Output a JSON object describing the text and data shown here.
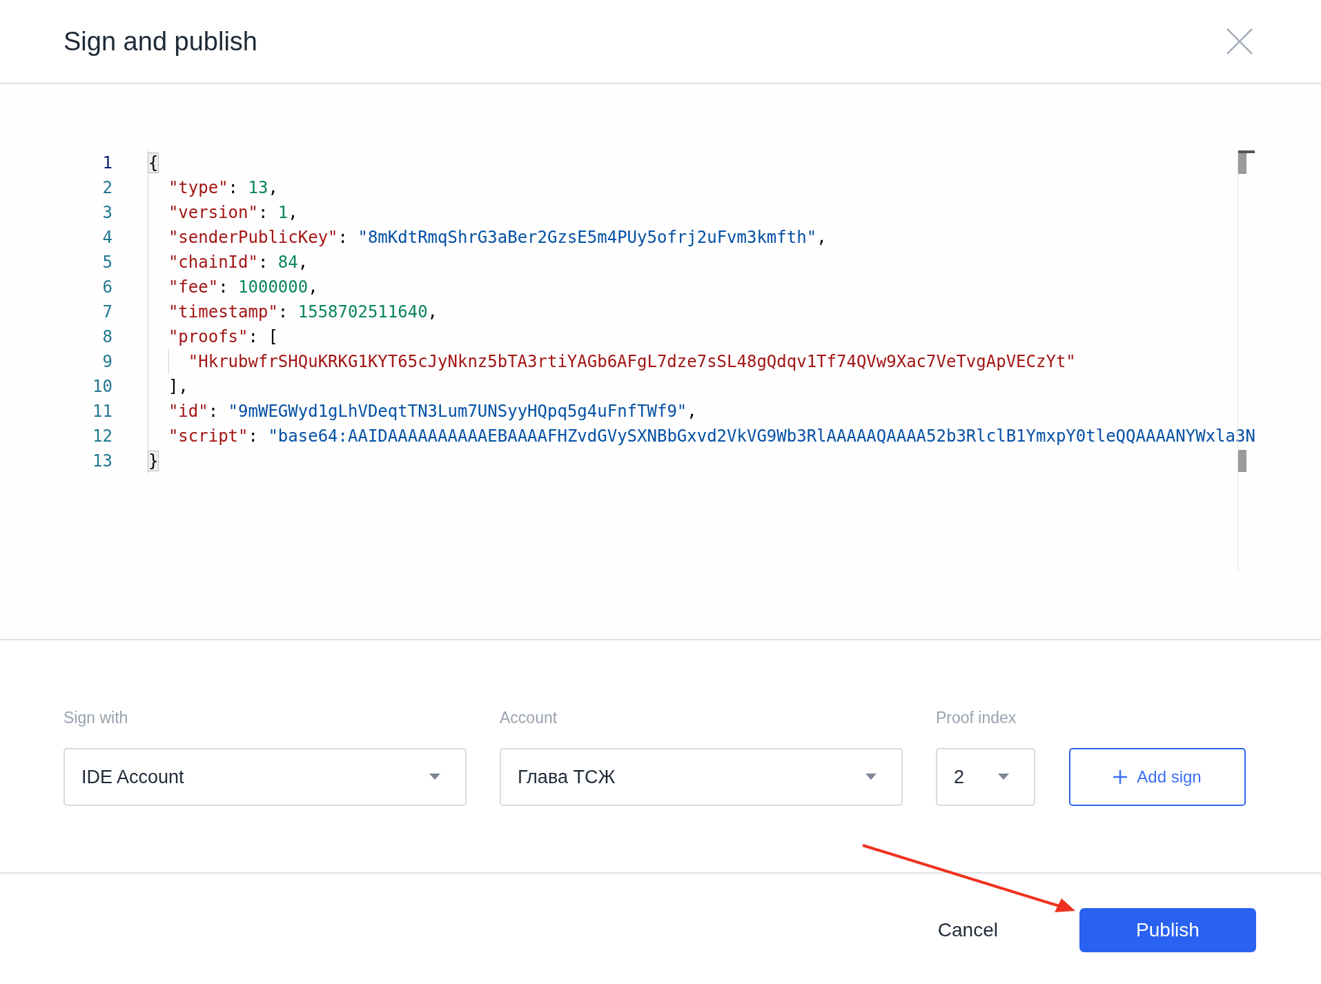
{
  "dialog": {
    "title": "Sign and publish"
  },
  "editor": {
    "lines": [
      {
        "number": "1",
        "active": true,
        "tokens": [
          {
            "kind": "bracket",
            "text": "{"
          }
        ]
      },
      {
        "number": "2",
        "active": false,
        "tokens": [
          {
            "kind": "key",
            "text": "  \"type\""
          },
          {
            "kind": "punct",
            "text": ": "
          },
          {
            "kind": "number",
            "text": "13"
          },
          {
            "kind": "punct",
            "text": ","
          }
        ]
      },
      {
        "number": "3",
        "active": false,
        "tokens": [
          {
            "kind": "key",
            "text": "  \"version\""
          },
          {
            "kind": "punct",
            "text": ": "
          },
          {
            "kind": "number",
            "text": "1"
          },
          {
            "kind": "punct",
            "text": ","
          }
        ]
      },
      {
        "number": "4",
        "active": false,
        "tokens": [
          {
            "kind": "key",
            "text": "  \"senderPublicKey\""
          },
          {
            "kind": "punct",
            "text": ": "
          },
          {
            "kind": "string",
            "text": "\"8mKdtRmqShrG3aBer2GzsE5m4PUy5ofrj2uFvm3kmfth\""
          },
          {
            "kind": "punct",
            "text": ","
          }
        ]
      },
      {
        "number": "5",
        "active": false,
        "tokens": [
          {
            "kind": "key",
            "text": "  \"chainId\""
          },
          {
            "kind": "punct",
            "text": ": "
          },
          {
            "kind": "number",
            "text": "84"
          },
          {
            "kind": "punct",
            "text": ","
          }
        ]
      },
      {
        "number": "6",
        "active": false,
        "tokens": [
          {
            "kind": "key",
            "text": "  \"fee\""
          },
          {
            "kind": "punct",
            "text": ": "
          },
          {
            "kind": "number",
            "text": "1000000"
          },
          {
            "kind": "punct",
            "text": ","
          }
        ]
      },
      {
        "number": "7",
        "active": false,
        "tokens": [
          {
            "kind": "key",
            "text": "  \"timestamp\""
          },
          {
            "kind": "punct",
            "text": ": "
          },
          {
            "kind": "number",
            "text": "1558702511640"
          },
          {
            "kind": "punct",
            "text": ","
          }
        ]
      },
      {
        "number": "8",
        "active": false,
        "tokens": [
          {
            "kind": "key",
            "text": "  \"proofs\""
          },
          {
            "kind": "punct",
            "text": ": ["
          }
        ]
      },
      {
        "number": "9",
        "active": false,
        "tokens": [
          {
            "kind": "key",
            "text": "    \"HkrubwfrSHQuKRKG1KYT65cJyNknz5bTA3rtiYAGb6AFgL7dze7sSL48gQdqv1Tf74QVw9Xac7VeTvgApVECzYt\""
          }
        ]
      },
      {
        "number": "10",
        "active": false,
        "tokens": [
          {
            "kind": "punct",
            "text": "  ],"
          }
        ]
      },
      {
        "number": "11",
        "active": false,
        "tokens": [
          {
            "kind": "key",
            "text": "  \"id\""
          },
          {
            "kind": "punct",
            "text": ": "
          },
          {
            "kind": "string",
            "text": "\"9mWEGWyd1gLhVDeqtTN3Lum7UNSyyHQpq5g4uFnfTWf9\""
          },
          {
            "kind": "punct",
            "text": ","
          }
        ]
      },
      {
        "number": "12",
        "active": false,
        "tokens": [
          {
            "kind": "key",
            "text": "  \"script\""
          },
          {
            "kind": "punct",
            "text": ": "
          },
          {
            "kind": "string",
            "text": "\"base64:AAIDAAAAAAAAAAEBAAAAFHZvdGVySXNBbGxvd2VkVG9Wb3RlAAAAAQAAAA52b3RlclB1YmxpY0tleQQAAAANYWxla3N"
          }
        ]
      },
      {
        "number": "13",
        "active": false,
        "tokens": [
          {
            "kind": "bracket",
            "text": "}"
          }
        ]
      }
    ]
  },
  "form": {
    "fields": [
      {
        "label": "Sign with",
        "value": "IDE Account"
      },
      {
        "label": "Account",
        "value": "Глава ТСЖ"
      },
      {
        "label": "Proof index",
        "value": "2"
      }
    ],
    "add_button": "Add sign"
  },
  "footer": {
    "cancel": "Cancel",
    "publish": "Publish"
  }
}
